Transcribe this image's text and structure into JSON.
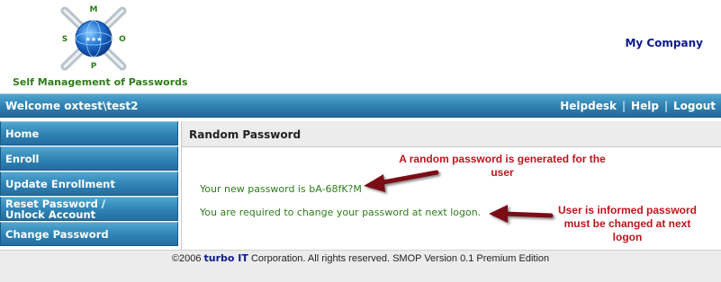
{
  "header": {
    "logo_letters": [
      "S",
      "M",
      "O",
      "P"
    ],
    "logo_caption": "Self Management of Passwords",
    "company": "My Company"
  },
  "topbar": {
    "welcome": "Welcome oxtest\\test2",
    "links": [
      "Helpdesk",
      "Help",
      "Logout"
    ],
    "separator": "|"
  },
  "sidebar": {
    "items": [
      {
        "label": "Home"
      },
      {
        "label": "Enroll"
      },
      {
        "label": "Update Enrollment"
      },
      {
        "label": "Reset Password /",
        "label2": "Unlock Account"
      },
      {
        "label": "Change Password"
      }
    ]
  },
  "panel": {
    "title": "Random Password",
    "message1": "Your new password is bA-68fK?M",
    "message2": "You are required to change your password at next logon."
  },
  "annotations": {
    "note1_line1": "A random password is generated for the",
    "note1_line2": "user",
    "note2_line1": "User is informed password",
    "note2_line2": "must be changed at next",
    "note2_line3": "logon"
  },
  "footer": {
    "copyright": "©2006",
    "brand": "turbo IT",
    "rest": "Corporation. All rights reserved. SMOP Version 0.1 Premium Edition"
  },
  "colors": {
    "bar_blue": "#2f7fb0",
    "message_green": "#2e7d1a",
    "annotation_red": "#c0141c",
    "company_navy": "#0d1a8c"
  },
  "icons": [
    "smop-compass-logo-icon",
    "arrow-icon"
  ]
}
